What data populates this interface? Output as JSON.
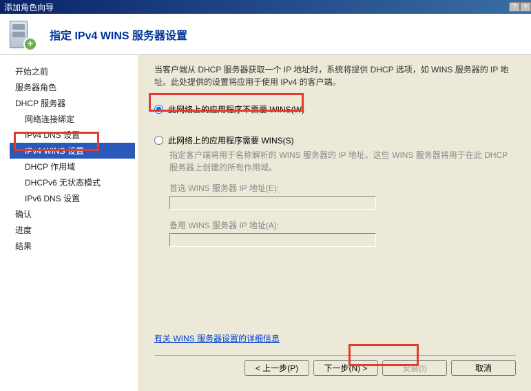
{
  "window": {
    "title": "添加角色向导"
  },
  "header": {
    "title": "指定 IPv4 WINS 服务器设置"
  },
  "sidebar": {
    "items": [
      {
        "label": "开始之前",
        "sub": false
      },
      {
        "label": "服务器角色",
        "sub": false
      },
      {
        "label": "DHCP 服务器",
        "sub": false
      },
      {
        "label": "网络连接绑定",
        "sub": true
      },
      {
        "label": "IPv4 DNS 设置",
        "sub": true
      },
      {
        "label": "IPv4 WINS 设置",
        "sub": true,
        "selected": true
      },
      {
        "label": "DHCP 作用域",
        "sub": true
      },
      {
        "label": "DHCPv6 无状态模式",
        "sub": true
      },
      {
        "label": "IPv6 DNS 设置",
        "sub": true
      },
      {
        "label": "确认",
        "sub": false
      },
      {
        "label": "进度",
        "sub": false
      },
      {
        "label": "结果",
        "sub": false
      }
    ]
  },
  "main": {
    "description": "当客户端从 DHCP 服务器获取一个 IP 地址时，系统将提供 DHCP 选项，如 WINS 服务器的 IP 地址。此处提供的设置将应用于使用 IPv4 的客户端。",
    "radio1": "此网络上的应用程序不需要 WINS(W)",
    "radio2": "此网络上的应用程序需要 WINS(S)",
    "subdesc": "指定客户端将用于名称解析的 WINS 服务器的 IP 地址。这些 WINS 服务器将用于在此 DHCP 服务器上创建的所有作用域。",
    "wins_primary_label": "首选 WINS 服务器 IP 地址(E):",
    "wins_primary_value": "",
    "wins_alt_label": "备用 WINS 服务器 IP 地址(A):",
    "wins_alt_value": "",
    "link": "有关 WINS 服务器设置的详细信息"
  },
  "buttons": {
    "prev": "< 上一步(P)",
    "next": "下一步(N) >",
    "install": "安装(I)",
    "cancel": "取消"
  }
}
